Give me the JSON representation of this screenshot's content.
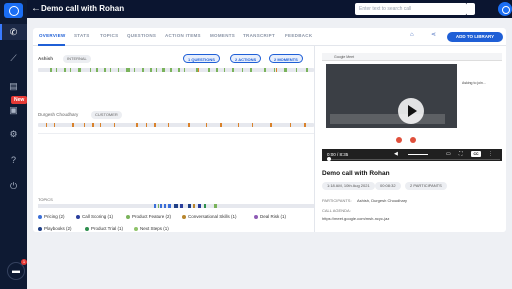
{
  "sidebar": {
    "new_badge": "New",
    "items": [
      {
        "icon": "phone-icon",
        "glyph": "✆"
      },
      {
        "icon": "chart-icon",
        "glyph": "⟋"
      },
      {
        "icon": "document-icon",
        "glyph": "▤"
      },
      {
        "icon": "library-icon",
        "glyph": "▣"
      },
      {
        "icon": "settings-icon",
        "glyph": "⚙"
      },
      {
        "icon": "help-icon",
        "glyph": "?"
      },
      {
        "icon": "logout-icon",
        "glyph": "⏻"
      }
    ],
    "chat_badge": "1"
  },
  "header": {
    "title": "Demo call with Rohan",
    "search_placeholder": "Enter text to search call"
  },
  "tabs": [
    "OVERVIEW",
    "STATS",
    "TOPICS",
    "QUESTIONS",
    "ACTION ITEMS",
    "MOMENTS",
    "TRANSCRIPT",
    "FEEDBACK"
  ],
  "active_tab": "OVERVIEW",
  "add_to_library": "ADD TO LIBRARY",
  "speakers": [
    {
      "name": "Ashish",
      "tag": "INTERNAL"
    },
    {
      "name": "Durgesh Choudhary",
      "tag": "CUSTOMER"
    }
  ],
  "chips": [
    "1 QUESTIONS",
    "2 ACTIONS",
    "2 MOMENTS"
  ],
  "topics": {
    "label": "TOPICS",
    "legend": [
      {
        "label": "Pricing (2)",
        "color": "#3b6fd8"
      },
      {
        "label": "Call Scoring (1)",
        "color": "#2a3e9c"
      },
      {
        "label": "Product Feature (2)",
        "color": "#7ab35b"
      },
      {
        "label": "Conversational Skills (1)",
        "color": "#b8862e"
      },
      {
        "label": "Deal Risk (1)",
        "color": "#8e5bb5"
      },
      {
        "label": "Playbooks (2)",
        "color": "#1f3f86"
      },
      {
        "label": "Product Trial (1)",
        "color": "#2f8f4e"
      },
      {
        "label": "Next Steps (1)",
        "color": "#8fc36a"
      }
    ]
  },
  "video": {
    "meet_label": "Google Meet",
    "side_note": "Asking to join…",
    "time": "0:00 / 8:35",
    "speed": "CC"
  },
  "meeting": {
    "title": "Demo call with Rohan",
    "date": "1:18 AM, 10th Aug 2021",
    "duration": "00:08:32",
    "participant_count": "2 PARTICIPANTS",
    "participants_label": "PARTICIPANTS:",
    "participants": "Ashish, Durgesh Choudhary",
    "agenda_label": "CALL AGENDA:",
    "agenda": "https://meet.google.com/msh-ncyc-jaz"
  },
  "colors": {
    "accent": "#1f5fd6",
    "sidebar": "#0e1a33",
    "green": "#7ab35b",
    "orange": "#d9822b"
  }
}
